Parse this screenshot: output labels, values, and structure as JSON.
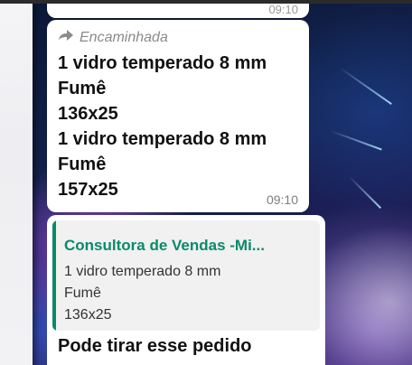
{
  "previous_message": {
    "time_partial": "09:10"
  },
  "message": {
    "forwarded_label": "Encaminhada",
    "lines": [
      "1 vidro temperado 8 mm",
      "Fumê",
      "136x25",
      "1 vidro temperado 8 mm",
      "Fumê",
      "157x25"
    ],
    "time": "09:10"
  },
  "reply": {
    "quoted_author": "Consultora de Vendas -Mi...",
    "quoted_lines": [
      "1 vidro temperado 8 mm",
      "Fumê",
      "136x25"
    ],
    "text": "Pode tirar esse pedido"
  },
  "icons": {
    "forward": "forward-arrow-icon"
  },
  "colors": {
    "quote_accent": "#0a8a6a",
    "bubble": "#ffffff",
    "timestamp": "#7d7d7d"
  }
}
